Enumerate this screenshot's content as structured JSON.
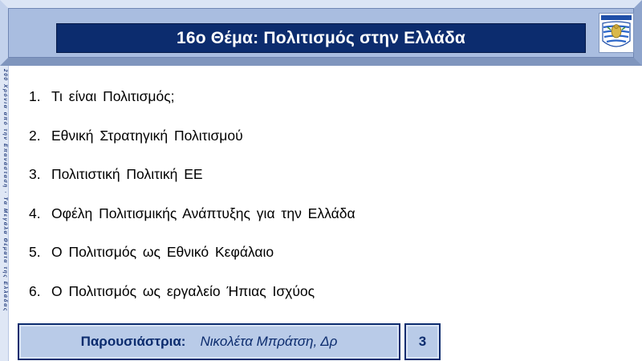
{
  "header": {
    "title": "16ο Θέμα: Πολιτισμός στην Ελλάδα",
    "logo_icon": "greek-emblem-logo",
    "colors": {
      "frame": "#a9bde0",
      "title_bar": "#0c2c6e",
      "title_text": "#ffffff"
    }
  },
  "side_strip": {
    "text": "200 Χρόνια από την Επανάσταση · Τα Μεγάλα Θέματα της Ελλάδας"
  },
  "agenda": {
    "items": [
      {
        "num": "1.",
        "label": "Τι είναι Πολιτισμός;"
      },
      {
        "num": "2.",
        "label": "Εθνική Στρατηγική Πολιτισμού"
      },
      {
        "num": "3.",
        "label": "Πολιτιστική Πολιτική ΕΕ"
      },
      {
        "num": "4.",
        "label": "Οφέλη Πολιτισμικής Ανάπτυξης για την Ελλάδα"
      },
      {
        "num": "5.",
        "label": "Ο Πολιτισμός ως Εθνικό Κεφάλαιο"
      },
      {
        "num": "6.",
        "label": "Ο Πολιτισμός ως εργαλείο Ήπιας Ισχύος"
      }
    ]
  },
  "footer": {
    "presenter_label": "Παρουσιάστρια:",
    "presenter_name": "Νικολέτα Μπράτση, Δρ",
    "page_number": "3",
    "colors": {
      "box_fill": "#b9cbe8",
      "box_border": "#0c2c6e"
    }
  }
}
